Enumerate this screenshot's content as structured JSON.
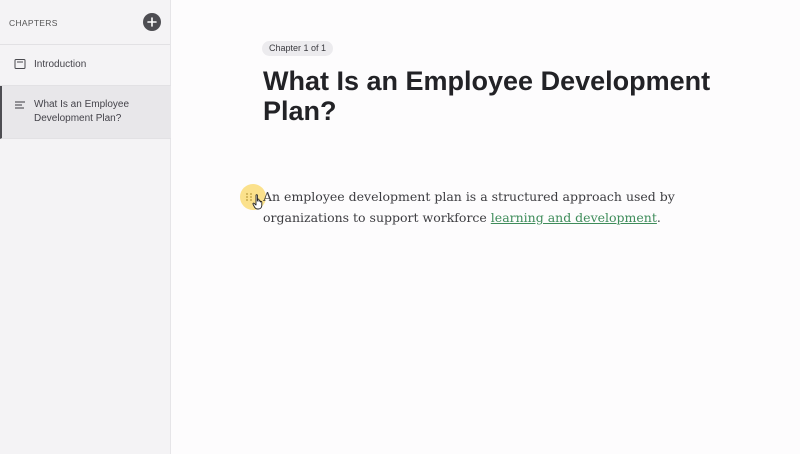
{
  "sidebar": {
    "title": "CHAPTERS",
    "add_icon": "plus-icon",
    "items": [
      {
        "label": "Introduction",
        "icon": "document-icon",
        "active": false
      },
      {
        "label": "What Is an Employee Development Plan?",
        "icon": "text-lines-icon",
        "active": true
      }
    ]
  },
  "main": {
    "chapter_badge": "Chapter 1 of 1",
    "title": "What Is an Employee Development Plan?",
    "paragraph": {
      "text_before": "An employee development plan is a structured approach used by organizations to support workforce ",
      "link_text": "learning and development",
      "text_after": "."
    },
    "colors": {
      "link": "#3e8c5a",
      "drag_handle_highlight": "#fadc78",
      "sidebar_bg": "#f4f3f5"
    }
  }
}
